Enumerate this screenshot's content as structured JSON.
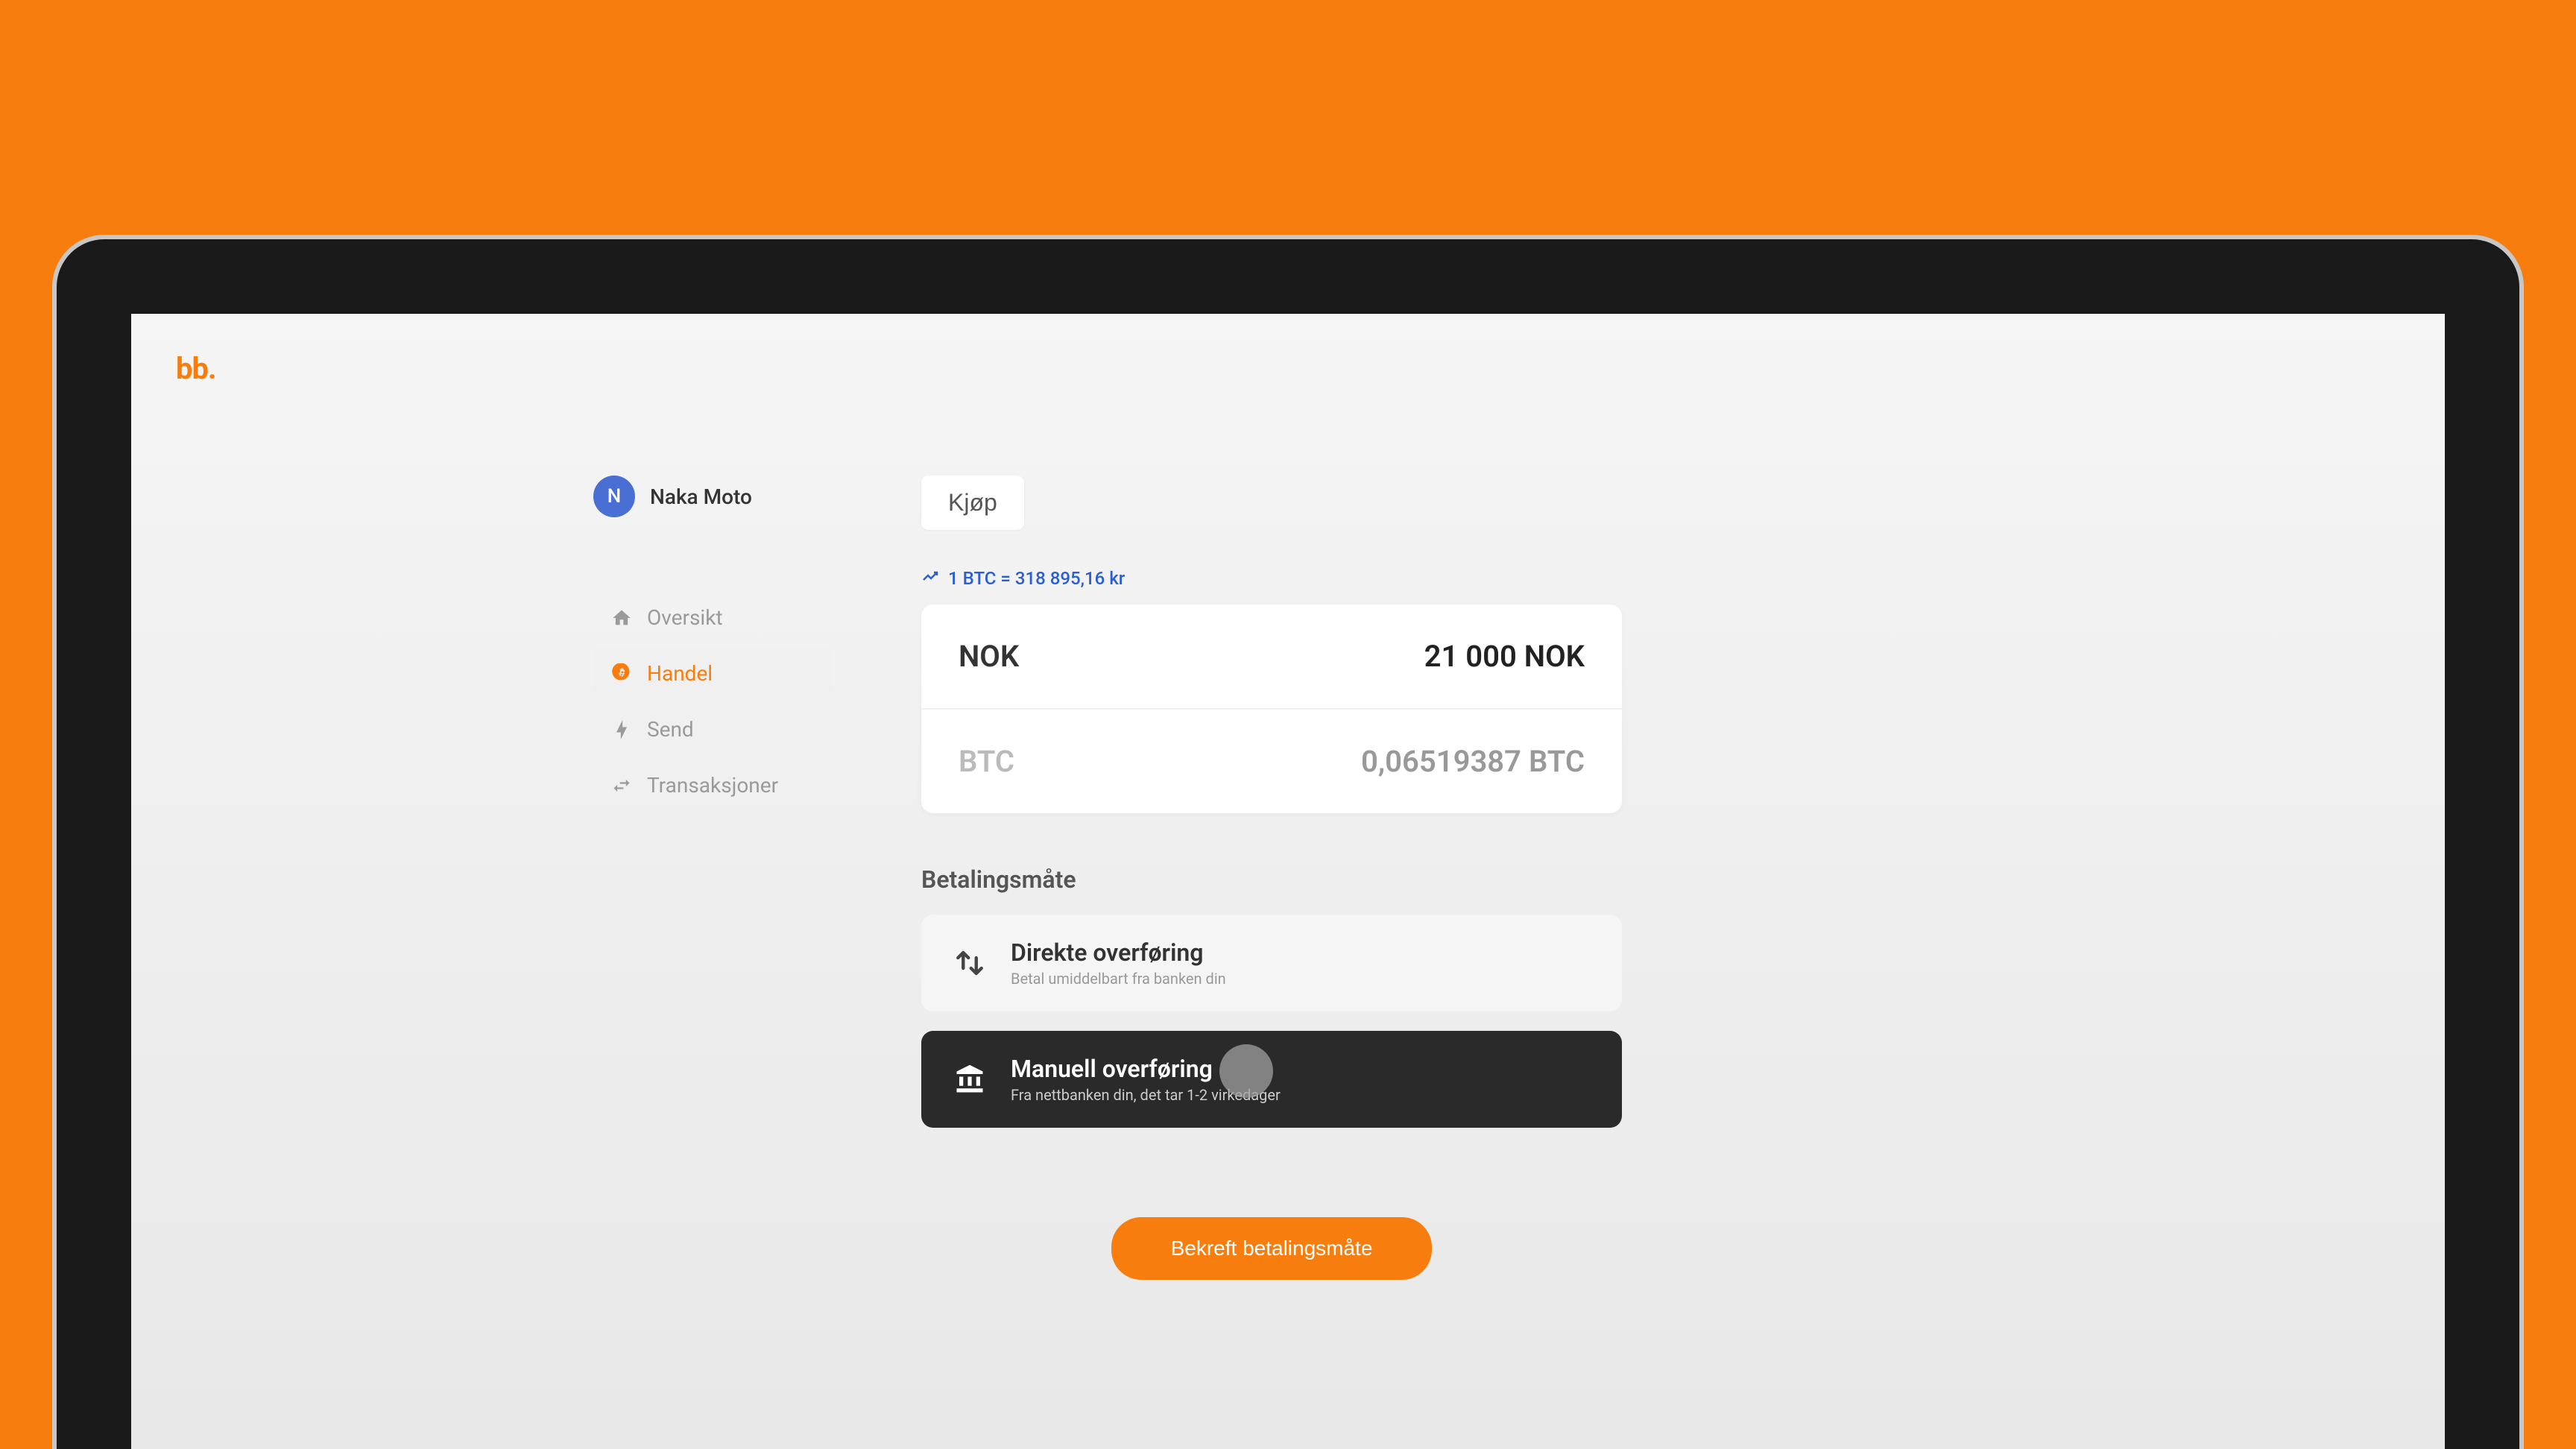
{
  "logo": "bb.",
  "user": {
    "initial": "N",
    "name": "Naka Moto"
  },
  "nav": {
    "items": [
      {
        "label": "Oversikt"
      },
      {
        "label": "Handel"
      },
      {
        "label": "Send"
      },
      {
        "label": "Transaksjoner"
      }
    ]
  },
  "tab": {
    "label": "Kjøp"
  },
  "rate": {
    "text": "1 BTC = 318 895,16 kr"
  },
  "conversion": {
    "from_currency": "NOK",
    "from_value": "21 000 NOK",
    "to_currency": "BTC",
    "to_value": "0,06519387 BTC"
  },
  "payment": {
    "section_title": "Betalingsmåte",
    "options": [
      {
        "title": "Direkte overføring",
        "subtitle": "Betal umiddelbart fra banken din"
      },
      {
        "title": "Manuell overføring",
        "subtitle": "Fra nettbanken din, det tar 1-2 virkedager"
      }
    ]
  },
  "confirm_button": "Bekreft betalingsmåte"
}
